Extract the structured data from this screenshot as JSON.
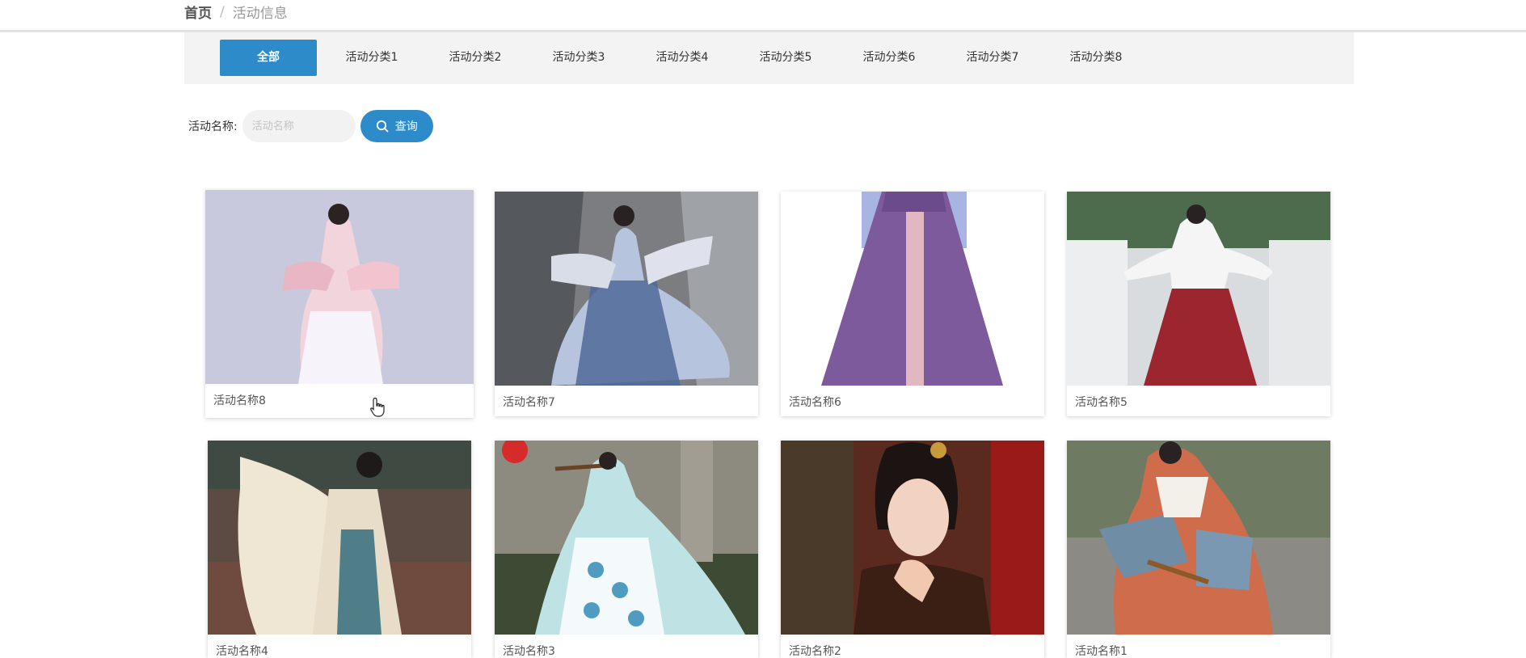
{
  "breadcrumb": {
    "home": "首页",
    "separator": "/",
    "current": "活动信息"
  },
  "categories": [
    "全部",
    "活动分类1",
    "活动分类2",
    "活动分类3",
    "活动分类4",
    "活动分类5",
    "活动分类6",
    "活动分类7",
    "活动分类8"
  ],
  "active_category": "全部",
  "search": {
    "label": "活动名称:",
    "placeholder": "活动名称",
    "value": "",
    "button_label": "查询",
    "button_icon": "search-icon"
  },
  "activities": [
    {
      "title": "活动名称8",
      "image": "hanfu-pink-floral-dress"
    },
    {
      "title": "活动名称7",
      "image": "hanfu-blue-gauze-dress"
    },
    {
      "title": "活动名称6",
      "image": "hanfu-purple-skirt"
    },
    {
      "title": "活动名称5",
      "image": "hanfu-white-red-dress"
    },
    {
      "title": "活动名称4",
      "image": "hanfu-cream-green-dress"
    },
    {
      "title": "活动名称3",
      "image": "hanfu-mint-flute-player"
    },
    {
      "title": "活动名称2",
      "image": "hanfu-portrait-red"
    },
    {
      "title": "活动名称1",
      "image": "hanfu-orange-blue-seated"
    }
  ],
  "colors": {
    "accent": "#2e8bca",
    "category_bar": "#f3f3f3",
    "input_bg": "#f2f2f2"
  }
}
